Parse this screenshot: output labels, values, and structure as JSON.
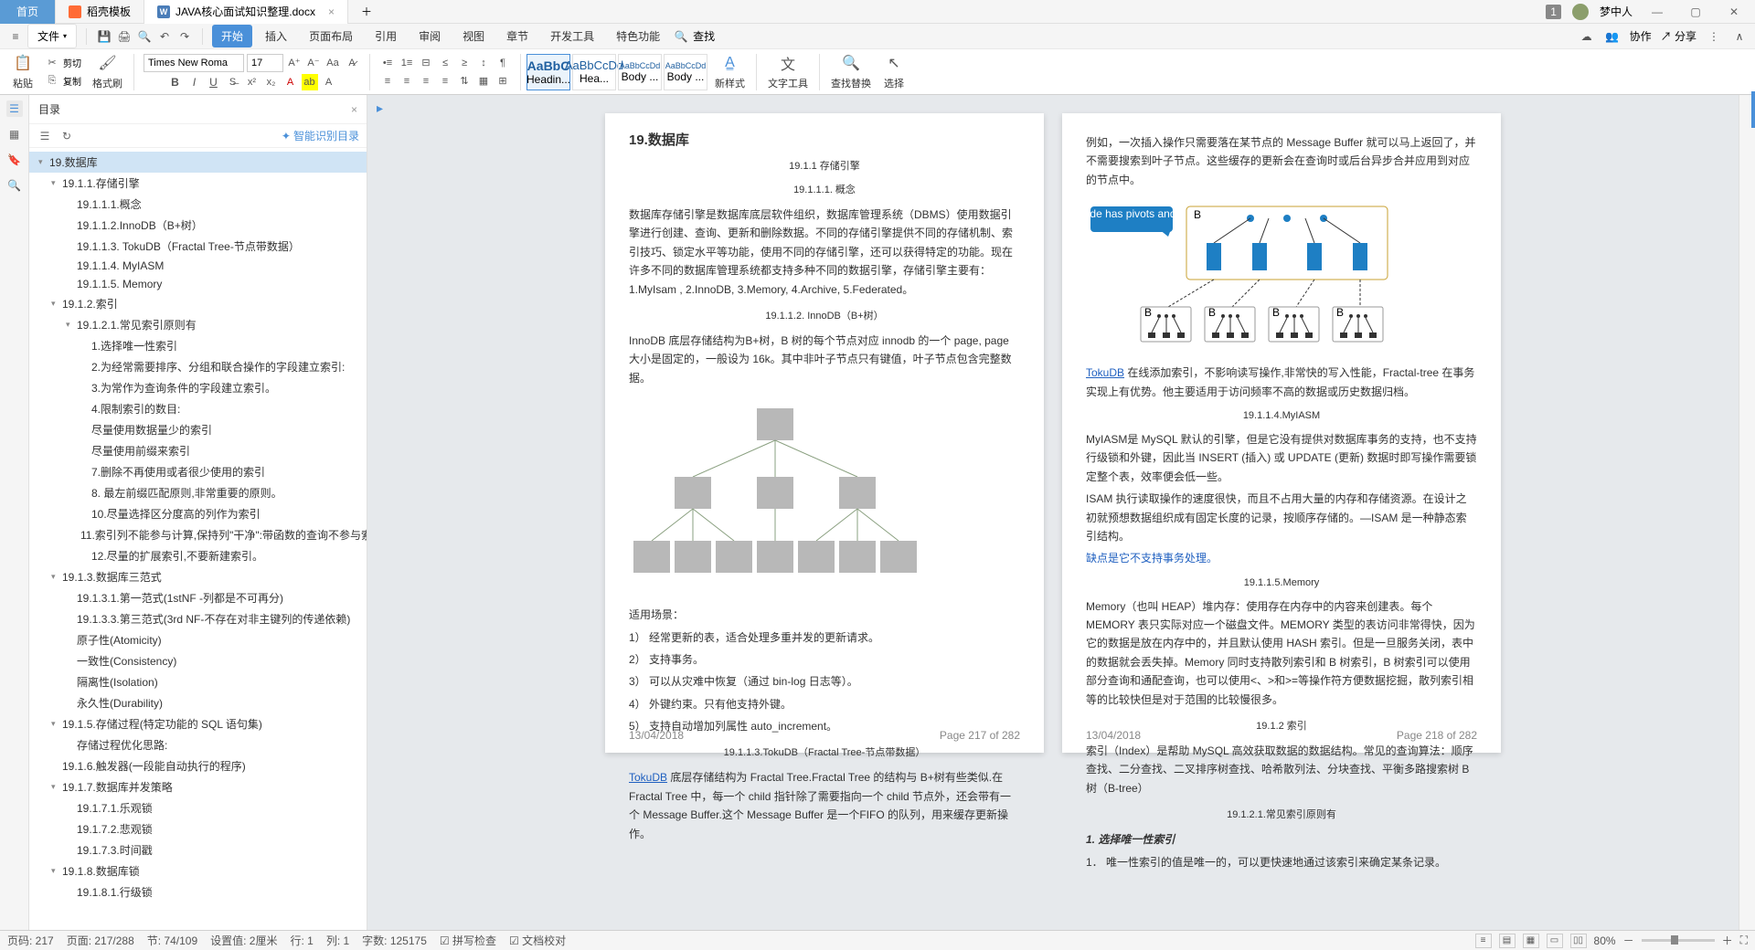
{
  "titlebar": {
    "home": "首页",
    "template": "稻壳模板",
    "doc": "JAVA核心面试知识整理.docx",
    "user": "梦中人",
    "badge": "1"
  },
  "menubar": {
    "file": "文件",
    "tabs": [
      "开始",
      "插入",
      "页面布局",
      "引用",
      "审阅",
      "视图",
      "章节",
      "开发工具",
      "特色功能"
    ],
    "find": "查找",
    "collab": "协作",
    "share": "分享"
  },
  "ribbon": {
    "paste": "粘贴",
    "cut": "剪切",
    "copy": "复制",
    "fmtpainter": "格式刷",
    "fontname": "Times New Roma",
    "fontsize": "17",
    "styles": [
      {
        "preview": "AaBbC",
        "label": "Headin..."
      },
      {
        "preview": "AaBbCcDd",
        "label": "Hea..."
      },
      {
        "preview": "AaBbCcDd",
        "label": "Body ..."
      },
      {
        "preview": "AaBbCcDd",
        "label": "Body ..."
      }
    ],
    "newstyle": "新样式",
    "texttool": "文字工具",
    "findreplace": "查找替换",
    "select": "选择"
  },
  "toc": {
    "title": "目录",
    "smart": "智能识别目录",
    "items": [
      {
        "lvl": 0,
        "arrow": "▾",
        "text": "19.数据库",
        "sel": true
      },
      {
        "lvl": 1,
        "arrow": "▾",
        "text": "19.1.1.存储引擎"
      },
      {
        "lvl": 2,
        "arrow": "",
        "text": "19.1.1.1.概念"
      },
      {
        "lvl": 2,
        "arrow": "",
        "text": "19.1.1.2.InnoDB（B+树）"
      },
      {
        "lvl": 2,
        "arrow": "",
        "text": "19.1.1.3. TokuDB（Fractal Tree-节点带数据）"
      },
      {
        "lvl": 2,
        "arrow": "",
        "text": "19.1.1.4. MyIASM"
      },
      {
        "lvl": 2,
        "arrow": "",
        "text": "19.1.1.5. Memory"
      },
      {
        "lvl": 1,
        "arrow": "▾",
        "text": "19.1.2.索引"
      },
      {
        "lvl": 2,
        "arrow": "▾",
        "text": "19.1.2.1.常见索引原则有"
      },
      {
        "lvl": 3,
        "arrow": "",
        "text": "1.选择唯一性索引"
      },
      {
        "lvl": 3,
        "arrow": "",
        "text": "2.为经常需要排序、分组和联合操作的字段建立索引:"
      },
      {
        "lvl": 3,
        "arrow": "",
        "text": "3.为常作为查询条件的字段建立索引。"
      },
      {
        "lvl": 3,
        "arrow": "",
        "text": "4.限制索引的数目:"
      },
      {
        "lvl": 3,
        "arrow": "",
        "text": "尽量使用数据量少的索引"
      },
      {
        "lvl": 3,
        "arrow": "",
        "text": "尽量使用前缀来索引"
      },
      {
        "lvl": 3,
        "arrow": "",
        "text": "7.删除不再使用或者很少使用的索引"
      },
      {
        "lvl": 3,
        "arrow": "",
        "text": "8. 最左前缀匹配原则,非常重要的原则。"
      },
      {
        "lvl": 3,
        "arrow": "",
        "text": "10.尽量选择区分度高的列作为索引"
      },
      {
        "lvl": 3,
        "arrow": "",
        "text": "11.索引列不能参与计算,保持列\"干净\":带函数的查询不参与索..."
      },
      {
        "lvl": 3,
        "arrow": "",
        "text": "12.尽量的扩展索引,不要新建索引。"
      },
      {
        "lvl": 1,
        "arrow": "▾",
        "text": "19.1.3.数据库三范式"
      },
      {
        "lvl": 2,
        "arrow": "",
        "text": "19.1.3.1.第一范式(1stNF -列都是不可再分)"
      },
      {
        "lvl": 2,
        "arrow": "",
        "text": "19.1.3.3.第三范式(3rd NF-不存在对非主键列的传递依赖)"
      },
      {
        "lvl": 2,
        "arrow": "",
        "text": "原子性(Atomicity)"
      },
      {
        "lvl": 2,
        "arrow": "",
        "text": "一致性(Consistency)"
      },
      {
        "lvl": 2,
        "arrow": "",
        "text": "隔离性(Isolation)"
      },
      {
        "lvl": 2,
        "arrow": "",
        "text": "永久性(Durability)"
      },
      {
        "lvl": 1,
        "arrow": "▾",
        "text": "19.1.5.存储过程(特定功能的 SQL 语句集)"
      },
      {
        "lvl": 2,
        "arrow": "",
        "text": "存储过程优化思路:"
      },
      {
        "lvl": 1,
        "arrow": "",
        "text": "19.1.6.触发器(一段能自动执行的程序)"
      },
      {
        "lvl": 1,
        "arrow": "▾",
        "text": "19.1.7.数据库并发策略"
      },
      {
        "lvl": 2,
        "arrow": "",
        "text": "19.1.7.1.乐观锁"
      },
      {
        "lvl": 2,
        "arrow": "",
        "text": "19.1.7.2.悲观锁"
      },
      {
        "lvl": 2,
        "arrow": "",
        "text": "19.1.7.3.时间戳"
      },
      {
        "lvl": 1,
        "arrow": "▾",
        "text": "19.1.8.数据库锁"
      },
      {
        "lvl": 2,
        "arrow": "",
        "text": "19.1.8.1.行级锁"
      }
    ]
  },
  "page1": {
    "title": "19.数据库",
    "h1": "19.1.1 存储引擎",
    "h2": "19.1.1.1.    概念",
    "p1": "数据库存储引擎是数据库底层软件组织，数据库管理系统（DBMS）使用数据引擎进行创建、查询、更新和删除数据。不同的存储引擎提供不同的存储机制、索引技巧、锁定水平等功能，使用不同的存储引擎，还可以获得特定的功能。现在许多不同的数据库管理系统都支持多种不同的数据引擎，存储引擎主要有：1.MyIsam , 2.InnoDB, 3.Memory, 4.Archive, 5.Federated。",
    "h3": "19.1.1.2.    InnoDB（B+树）",
    "p2": "InnoDB 底层存储结构为B+树，B 树的每个节点对应 innodb 的一个 page, page 大小是固定的，一般设为 16k。其中非叶子节点只有键值，叶子节点包含完整数据。",
    "scenes": "适用场景：",
    "s1": "1）  经常更新的表，适合处理多重并发的更新请求。",
    "s2": "2）  支持事务。",
    "s3": "3）  可以从灾难中恢复（通过 bin-log 日志等）。",
    "s4": "4）  外键约束。只有他支持外键。",
    "s5": "5）  支持自动增加列属性 auto_increment。",
    "h4": "19.1.1.3.TokuDB（Fractal Tree-节点带数据）",
    "p3a": "TokuDB",
    "p3b": "底层存储结构为 Fractal Tree.Fractal Tree 的结构与 B+树有些类似.在 Fractal Tree 中，每一个 child 指针除了需要指向一个 child 节点外，还会带有一个 Message Buffer.这个 Message Buffer 是一个FIFO 的队列，用来缓存更新操作。",
    "date": "13/04/2018",
    "pageno": "Page 217 of 282"
  },
  "page2": {
    "p0": "例如，一次插入操作只需要落在某节点的 Message Buffer 就可以马上返回了，并不需要搜索到叶子节点。这些缓存的更新会在查询时或后台异步合并应用到对应的节点中。",
    "callout": "Each node has pivots and Buffers",
    "p1a": "TokuDB",
    "p1b": "在线添加索引，不影响读写操作,非常快的写入性能，Fractal-tree 在事务实现上有优势。他主要适用于访问频率不高的数据或历史数据归档。",
    "h1": "19.1.1.4.MyIASM",
    "p2": "MyIASM是 MySQL 默认的引擎，但是它没有提供对数据库事务的支持，也不支持行级锁和外键，因此当 INSERT (插入) 或 UPDATE (更新) 数据时即写操作需要锁定整个表，效率便会低一些。",
    "p3": "ISAM 执行读取操作的速度很快，而且不占用大量的内存和存储资源。在设计之初就预想数据组织成有固定长度的记录，按顺序存储的。—ISAM 是一种静态索引结构。",
    "p4": "缺点是它不支持事务处理。",
    "h2": "19.1.1.5.Memory",
    "p5": "Memory（也叫 HEAP）堆内存：使用存在内存中的内容来创建表。每个 MEMORY 表只实际对应一个磁盘文件。MEMORY 类型的表访问非常得快，因为它的数据是放在内存中的，并且默认使用 HASH 索引。但是一旦服务关闭，表中的数据就会丢失掉。Memory 同时支持散列索引和 B 树索引，B 树索引可以使用部分查询和通配查询，也可以使用<、>和>=等操作符方便数据挖掘，散列索引相等的比较快但是对于范围的比较慢很多。",
    "h3": "19.1.2 索引",
    "p6": "索引（Index）是帮助 MySQL 高效获取数据的数据结构。常见的查询算法：顺序查找、二分查找、二叉排序树查找、哈希散列法、分块查找、平衡多路搜索树 B 树（B-tree）",
    "h4": "19.1.2.1.常见索引原则有",
    "s1": "1.   选择唯一性索引",
    "s2": "1．  唯一性索引的值是唯一的，可以更快速地通过该索引来确定某条记录。",
    "date": "13/04/2018",
    "pageno": "Page 218 of 282"
  },
  "status": {
    "page": "页码: 217",
    "pages": "页面: 217/288",
    "section": "节: 74/109",
    "setval": "设置值: 2厘米",
    "row": "行: 1",
    "col": "列: 1",
    "chars": "字数: 125175",
    "spell": "拼写检查",
    "proof": "文档校对",
    "zoom": "80%"
  }
}
